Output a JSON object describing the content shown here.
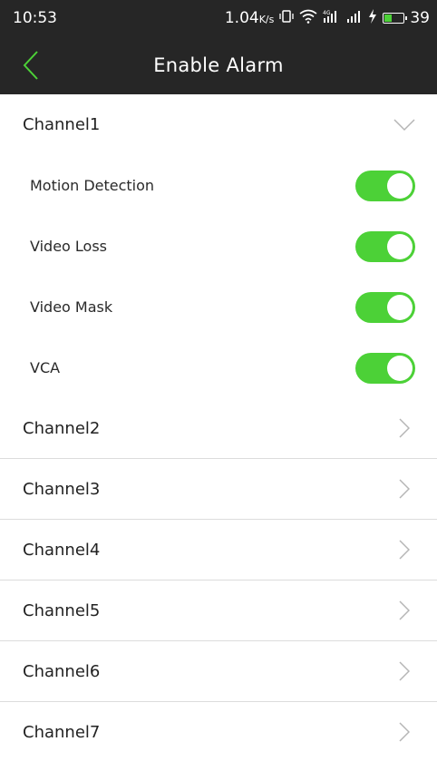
{
  "status_bar": {
    "time": "10:53",
    "net_speed": "1.04",
    "net_unit": "K/s",
    "battery": "39",
    "battery_level": 0.39,
    "battery_color": "#4cd137"
  },
  "header": {
    "title": "Enable Alarm",
    "back_icon": "chevron-left-icon",
    "accent_color": "#4cd137"
  },
  "channels": [
    {
      "label": "Channel1",
      "expanded": true,
      "options": [
        {
          "label": "Motion Detection",
          "enabled": true
        },
        {
          "label": "Video Loss",
          "enabled": true
        },
        {
          "label": "Video Mask",
          "enabled": true
        },
        {
          "label": "VCA",
          "enabled": true
        }
      ]
    },
    {
      "label": "Channel2",
      "expanded": false
    },
    {
      "label": "Channel3",
      "expanded": false
    },
    {
      "label": "Channel4",
      "expanded": false
    },
    {
      "label": "Channel5",
      "expanded": false
    },
    {
      "label": "Channel6",
      "expanded": false
    },
    {
      "label": "Channel7",
      "expanded": false
    }
  ],
  "colors": {
    "toggle_on": "#4cd137",
    "bar_background": "#262626",
    "chevron": "#b5b5b5"
  }
}
